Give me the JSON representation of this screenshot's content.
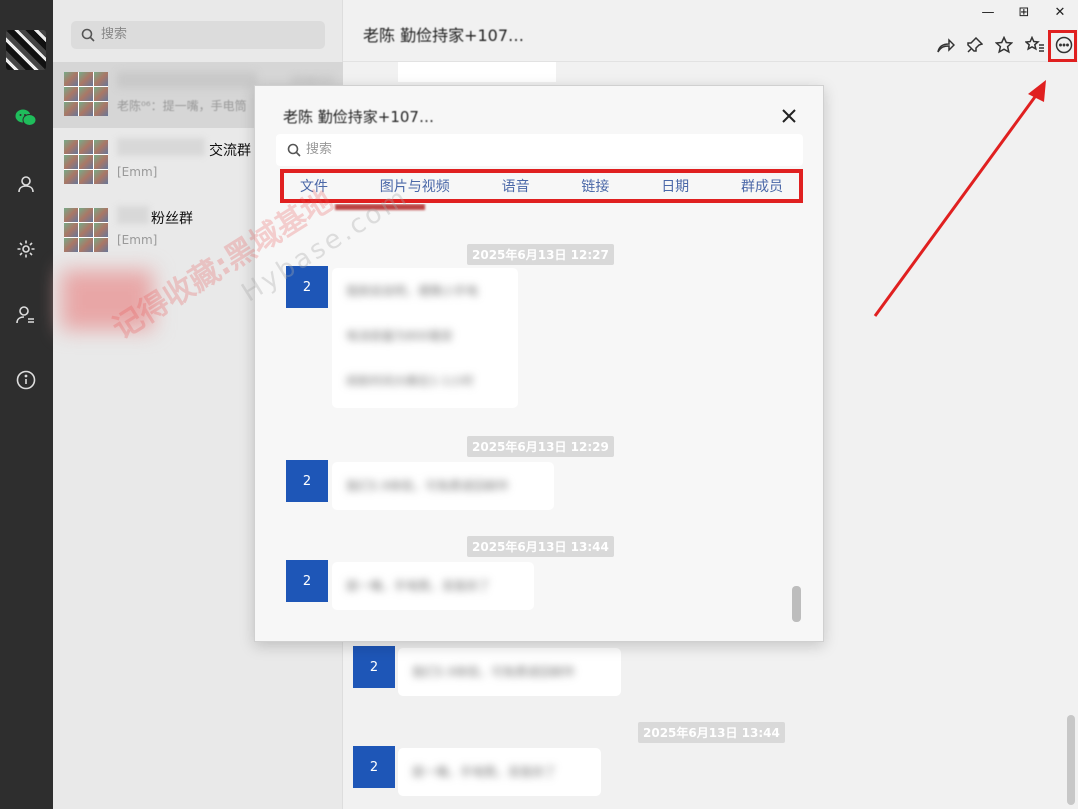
{
  "sidebar": {
    "icons": [
      "avatar",
      "chat-icon",
      "contacts-icon",
      "settings-icon",
      "user-switch-icon",
      "info-icon"
    ]
  },
  "conversation_list": {
    "search_placeholder": "搜索",
    "items": [
      {
        "title": "",
        "preview": "老陈⁰⁶：提一嘴，手电筒",
        "time": "25/6/13",
        "active": true
      },
      {
        "title": "交流群",
        "preview": "[Emm]",
        "time": ""
      },
      {
        "title": "粉丝群",
        "preview": "[Emm]",
        "time": ""
      },
      {
        "title": "",
        "preview": "",
        "time": ""
      }
    ]
  },
  "chat": {
    "title": "老陈 勤俭持家+107…",
    "stamp_1": "2025年6月13日 13:44",
    "avatar_label": "2",
    "bubble_1": "我们5.9体现，可免费退回邮件",
    "bubble_2": "提一嘴，手电筒，丢我存了"
  },
  "window_controls": {
    "minimize": "—",
    "maximize": "⊞",
    "close": "✕"
  },
  "history_popup": {
    "title": "老陈 勤俭持家+107…",
    "search_placeholder": "搜索",
    "filters": [
      "文件",
      "图片与视频",
      "语音",
      "链接",
      "日期",
      "群成员"
    ],
    "messages": [
      {
        "time": "2025年6月13日 12:27",
        "avatar": "2",
        "lines": [
          "我刚说说吧，便携小手电",
          "电池容量为800毫安",
          "续航时间大概在1-1小时"
        ]
      },
      {
        "time": "2025年6月13日 12:29",
        "avatar": "2",
        "lines": [
          "我们5.9体现，可免费退回邮件"
        ]
      },
      {
        "time": "2025年6月13日 13:44",
        "avatar": "2",
        "lines": [
          "提一嘴，手电筒，丢我存了"
        ]
      }
    ]
  },
  "watermarks": [
    "记得收藏:黑域基地",
    "Hybase.com"
  ]
}
